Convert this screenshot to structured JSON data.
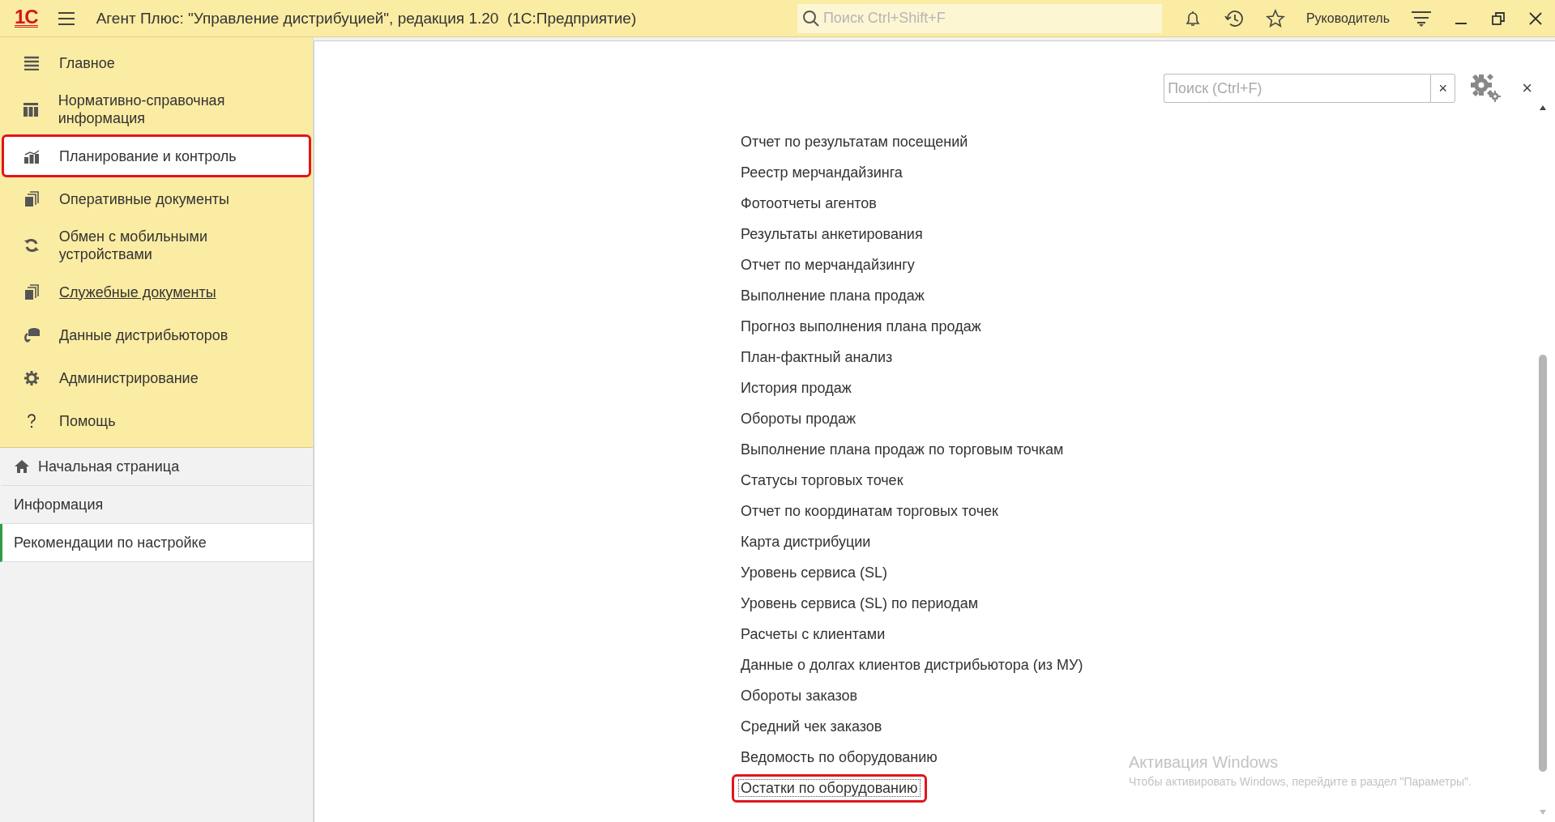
{
  "title_bar": {
    "logo": "1С",
    "title": "Агент Плюс: \"Управление дистрибуцией\", редакция 1.20  (1С:Предприятие)",
    "search": {
      "placeholder": "Поиск Ctrl+Shift+F"
    },
    "user": "Руководитель"
  },
  "sidebar": {
    "sections": [
      {
        "label": "Главное",
        "selected": false,
        "highlighted": false,
        "hovered": false
      },
      {
        "label": "Нормативно-справочная информация",
        "selected": false,
        "highlighted": false,
        "hovered": false
      },
      {
        "label": "Планирование и контроль",
        "selected": true,
        "highlighted": true,
        "hovered": false
      },
      {
        "label": "Оперативные документы",
        "selected": false,
        "highlighted": false,
        "hovered": false
      },
      {
        "label": "Обмен с мобильными устройствами",
        "selected": false,
        "highlighted": false,
        "hovered": false
      },
      {
        "label": "Служебные документы",
        "selected": false,
        "highlighted": false,
        "hovered": true
      },
      {
        "label": "Данные дистрибьюторов",
        "selected": false,
        "highlighted": false,
        "hovered": false
      },
      {
        "label": "Администрирование",
        "selected": false,
        "highlighted": false,
        "hovered": false
      },
      {
        "label": "Помощь",
        "selected": false,
        "highlighted": false,
        "hovered": false
      }
    ],
    "pages": [
      {
        "label": "Начальная страница",
        "kind": "home",
        "selected": false
      },
      {
        "label": "Информация",
        "kind": "plain",
        "selected": false
      },
      {
        "label": "Рекомендации по настройке",
        "kind": "plain",
        "selected": true
      }
    ]
  },
  "panel": {
    "search": {
      "placeholder": "Поиск (Ctrl+F)",
      "clear": "×"
    },
    "close": "×",
    "items": [
      {
        "label": "Отчет по результатам посещений",
        "highlighted": false,
        "focused": false
      },
      {
        "label": "Реестр мерчандайзинга",
        "highlighted": false,
        "focused": false
      },
      {
        "label": "Фотоотчеты агентов",
        "highlighted": false,
        "focused": false
      },
      {
        "label": "Результаты анкетирования",
        "highlighted": false,
        "focused": false
      },
      {
        "label": "Отчет по  мерчандайзингу",
        "highlighted": false,
        "focused": false
      },
      {
        "label": "Выполнение плана продаж",
        "highlighted": false,
        "focused": false
      },
      {
        "label": "Прогноз выполнения плана продаж",
        "highlighted": false,
        "focused": false
      },
      {
        "label": "План-фактный анализ",
        "highlighted": false,
        "focused": false
      },
      {
        "label": "История продаж",
        "highlighted": false,
        "focused": false
      },
      {
        "label": "Обороты продаж",
        "highlighted": false,
        "focused": false
      },
      {
        "label": "Выполнение плана продаж по торговым точкам",
        "highlighted": false,
        "focused": false
      },
      {
        "label": "Статусы торговых точек",
        "highlighted": false,
        "focused": false
      },
      {
        "label": "Отчет по координатам торговых точек",
        "highlighted": false,
        "focused": false
      },
      {
        "label": "Карта дистрибуции",
        "highlighted": false,
        "focused": false
      },
      {
        "label": "Уровень сервиса (SL)",
        "highlighted": false,
        "focused": false
      },
      {
        "label": "Уровень сервиса (SL) по периодам",
        "highlighted": false,
        "focused": false
      },
      {
        "label": "Расчеты с клиентами",
        "highlighted": false,
        "focused": false
      },
      {
        "label": "Данные о долгах клиентов дистрибьютора (из МУ)",
        "highlighted": false,
        "focused": false
      },
      {
        "label": "Обороты заказов",
        "highlighted": false,
        "focused": false
      },
      {
        "label": "Средний чек заказов",
        "highlighted": false,
        "focused": false
      },
      {
        "label": "Ведомость по оборудованию",
        "highlighted": false,
        "focused": false
      },
      {
        "label": "Остатки по оборудованию",
        "highlighted": true,
        "focused": true
      }
    ]
  },
  "os_notice": {
    "title": "Активация Windows",
    "text": "Чтобы активировать Windows, перейдите в раздел \"Параметры\"."
  }
}
